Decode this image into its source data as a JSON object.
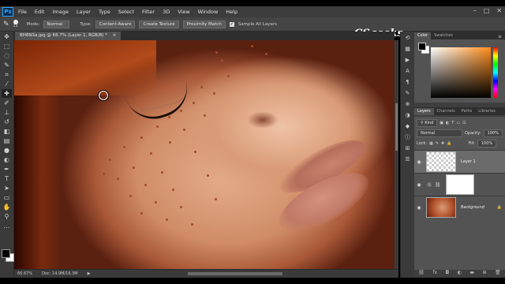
{
  "menubar": {
    "logo": "Ps",
    "items": [
      "File",
      "Edit",
      "Image",
      "Layer",
      "Type",
      "Select",
      "Filter",
      "3D",
      "View",
      "Window",
      "Help"
    ],
    "window_controls": [
      "–",
      "□",
      "✕"
    ]
  },
  "options_bar": {
    "brush_size": "13",
    "mode_label": "Mode:",
    "mode_value": "Normal",
    "type_label": "Type:",
    "content_aware": "Content-Aware",
    "create_texture": "Create Texture",
    "proximity_match": "Proximity Match",
    "sample_all_layers": "Sample All Layers"
  },
  "watermark": "CSgeeks",
  "document": {
    "tab_title": "BH8NSa.jpg @ 66.7% (Layer 1, RGB/8) *",
    "close": "×"
  },
  "status": {
    "zoom": "66.67%",
    "doc_size": "Doc: 14.9M/16.3M",
    "arrow": "▶"
  },
  "color_panel": {
    "tabs": [
      "Color",
      "Swatches"
    ],
    "fg_color": "#000000",
    "bg_color": "#ffffff",
    "picker_hue": "#ff8c1a"
  },
  "layers_panel": {
    "tabs": [
      "Layers",
      "Channels",
      "Paths",
      "Libraries"
    ],
    "kind_label": "Kind",
    "blend_mode": "Normal",
    "opacity_label": "Opacity:",
    "opacity_value": "100%",
    "lock_label": "Lock:",
    "fill_label": "Fill:",
    "fill_value": "100%",
    "layers": [
      {
        "name": "Layer 1",
        "type": "transparent",
        "active": true
      },
      {
        "name": "",
        "type": "adjustment",
        "active": false
      },
      {
        "name": "Background",
        "type": "photo",
        "active": false
      }
    ],
    "bottom_icons": [
      "link-icon",
      "fx-icon",
      "mask-icon",
      "adjustment-icon",
      "folder-icon",
      "new-layer-icon",
      "trash-icon"
    ]
  }
}
